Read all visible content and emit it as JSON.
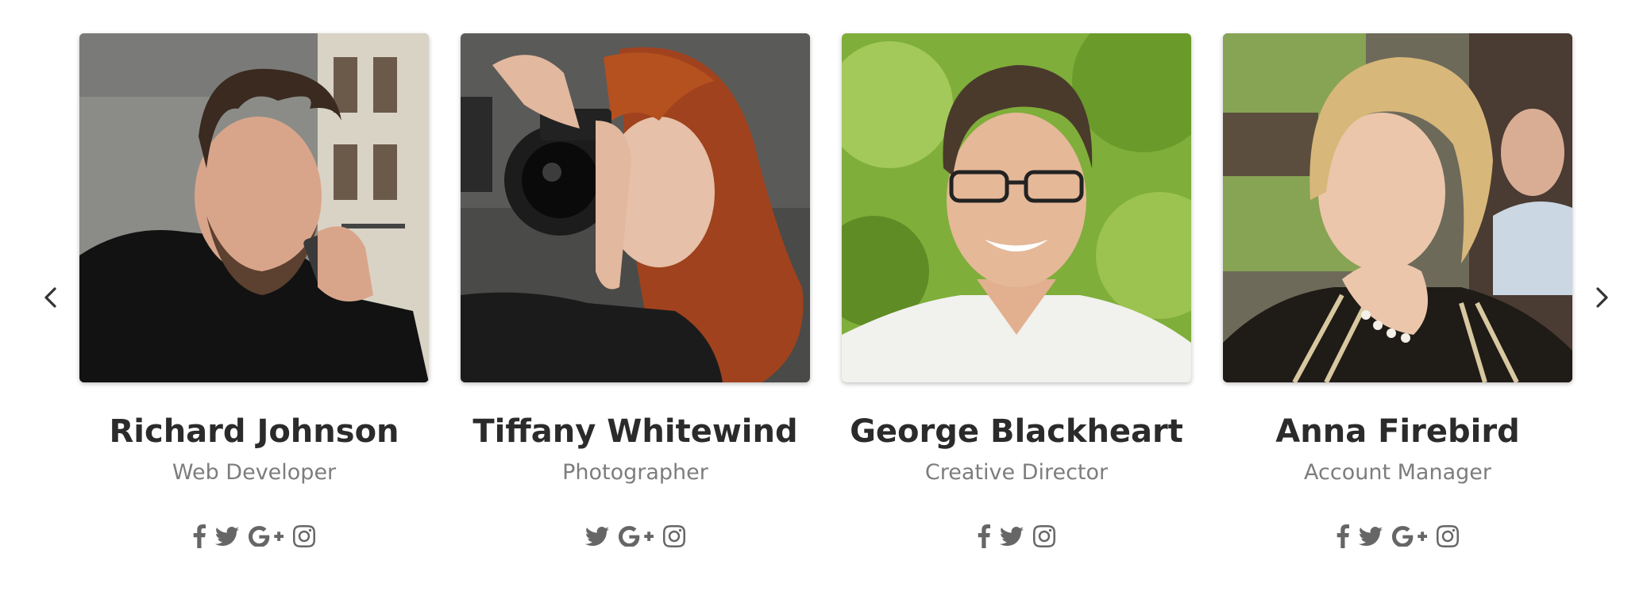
{
  "carousel": {
    "prev_icon": "chevron-left-icon",
    "next_icon": "chevron-right-icon",
    "members": [
      {
        "name": "Richard Johnson",
        "role": "Web Developer",
        "socials": [
          "facebook",
          "twitter",
          "google-plus",
          "instagram"
        ]
      },
      {
        "name": "Tiffany Whitewind",
        "role": "Photographer",
        "socials": [
          "twitter",
          "google-plus",
          "instagram"
        ]
      },
      {
        "name": "George Blackheart",
        "role": "Creative Director",
        "socials": [
          "facebook",
          "twitter",
          "instagram"
        ]
      },
      {
        "name": "Anna Firebird",
        "role": "Account Manager",
        "socials": [
          "facebook",
          "twitter",
          "google-plus",
          "instagram"
        ]
      }
    ]
  },
  "colors": {
    "name_text": "#2b2b2b",
    "role_text": "#7d7d7d",
    "icon": "#666666"
  }
}
